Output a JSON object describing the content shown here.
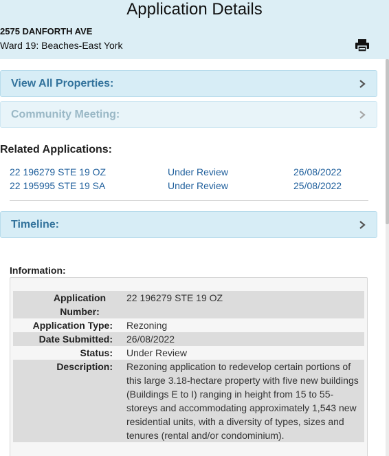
{
  "header": {
    "title": "Application Details",
    "address": "2575 DANFORTH AVE",
    "ward": "Ward 19: Beaches-East York",
    "print_icon": "printer-icon"
  },
  "panels": {
    "view_all_properties": "View All Properties:",
    "community_meeting": "Community Meeting:",
    "timeline": "Timeline:"
  },
  "related": {
    "title": "Related Applications:",
    "rows": [
      {
        "number": "22 196279 STE 19 OZ",
        "status": "Under Review",
        "date": "26/08/2022"
      },
      {
        "number": "22 195995 STE 19 SA",
        "status": "Under Review",
        "date": "25/08/2022"
      }
    ]
  },
  "information": {
    "title": "Information:",
    "application_number_label": "Application Number:",
    "application_number": "22 196279 STE 19 OZ",
    "application_type_label": "Application Type:",
    "application_type": "Rezoning",
    "date_submitted_label": "Date Submitted:",
    "date_submitted": "26/08/2022",
    "status_label": "Status:",
    "status": "Under Review",
    "description_label": "Description:",
    "description": "Rezoning application to redevelop certain portions of this large 3.18-hectare property with five new buildings (Buildings E to I) ranging in height from 15 to 55-storeys and accommodating approximately 1,543 new residential units, with a diversity of types, sizes and tenures (rental and/or condominium)."
  },
  "colors": {
    "header_bg": "#dceef5",
    "panel_bg": "#d7edf6",
    "panel_label": "#33739c",
    "link": "#1f5f9c"
  }
}
